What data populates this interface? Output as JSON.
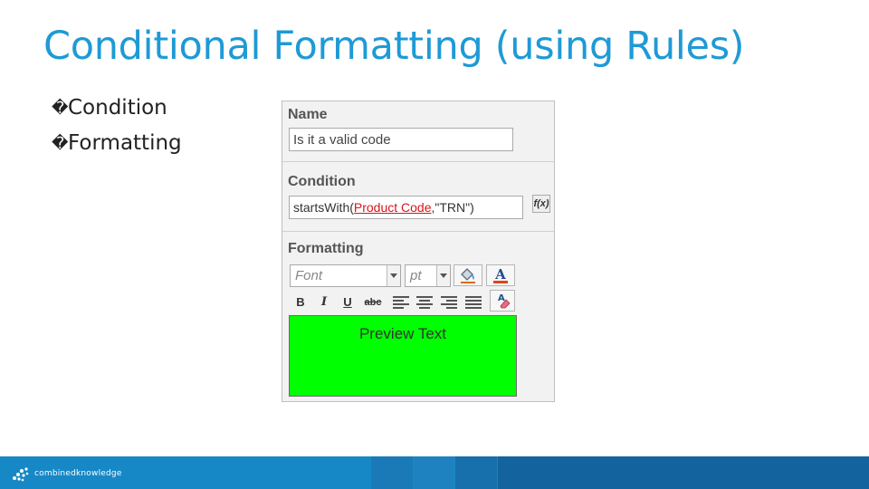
{
  "slide": {
    "title": "Conditional Formatting (using Rules)",
    "bullets": [
      {
        "glyph": "�",
        "text": "Condition"
      },
      {
        "glyph": "�",
        "text": "Formatting"
      }
    ]
  },
  "rule_panel": {
    "name_label": "Name",
    "name_value": "Is it a valid code",
    "condition_label": "Condition",
    "condition_fn_open": "startsWith(",
    "condition_field": "Product Code",
    "condition_rest": ",\"TRN\")",
    "formula_button": "f(x)",
    "formatting_label": "Formatting",
    "font_placeholder": "Font",
    "size_placeholder": "pt",
    "bold_label": "B",
    "italic_label": "I",
    "underline_label": "U",
    "strike_label": "abc",
    "preview_text": "Preview Text",
    "preview_bg": "#00ff00"
  },
  "footer": {
    "brand": "combinedknowledge",
    "color": "#1788c6"
  }
}
